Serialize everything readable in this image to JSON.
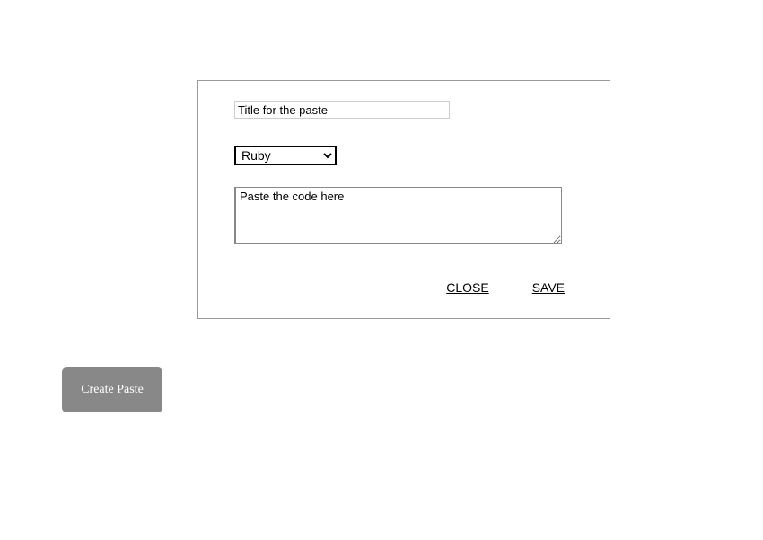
{
  "modal": {
    "title_placeholder": "Title for the paste",
    "title_value": "",
    "language_selected": "Ruby",
    "language_options": [
      "Ruby"
    ],
    "code_placeholder": "Paste the code here",
    "code_value": "",
    "close_label": "CLOSE",
    "save_label": "SAVE"
  },
  "page": {
    "create_paste_label": "Create Paste"
  }
}
